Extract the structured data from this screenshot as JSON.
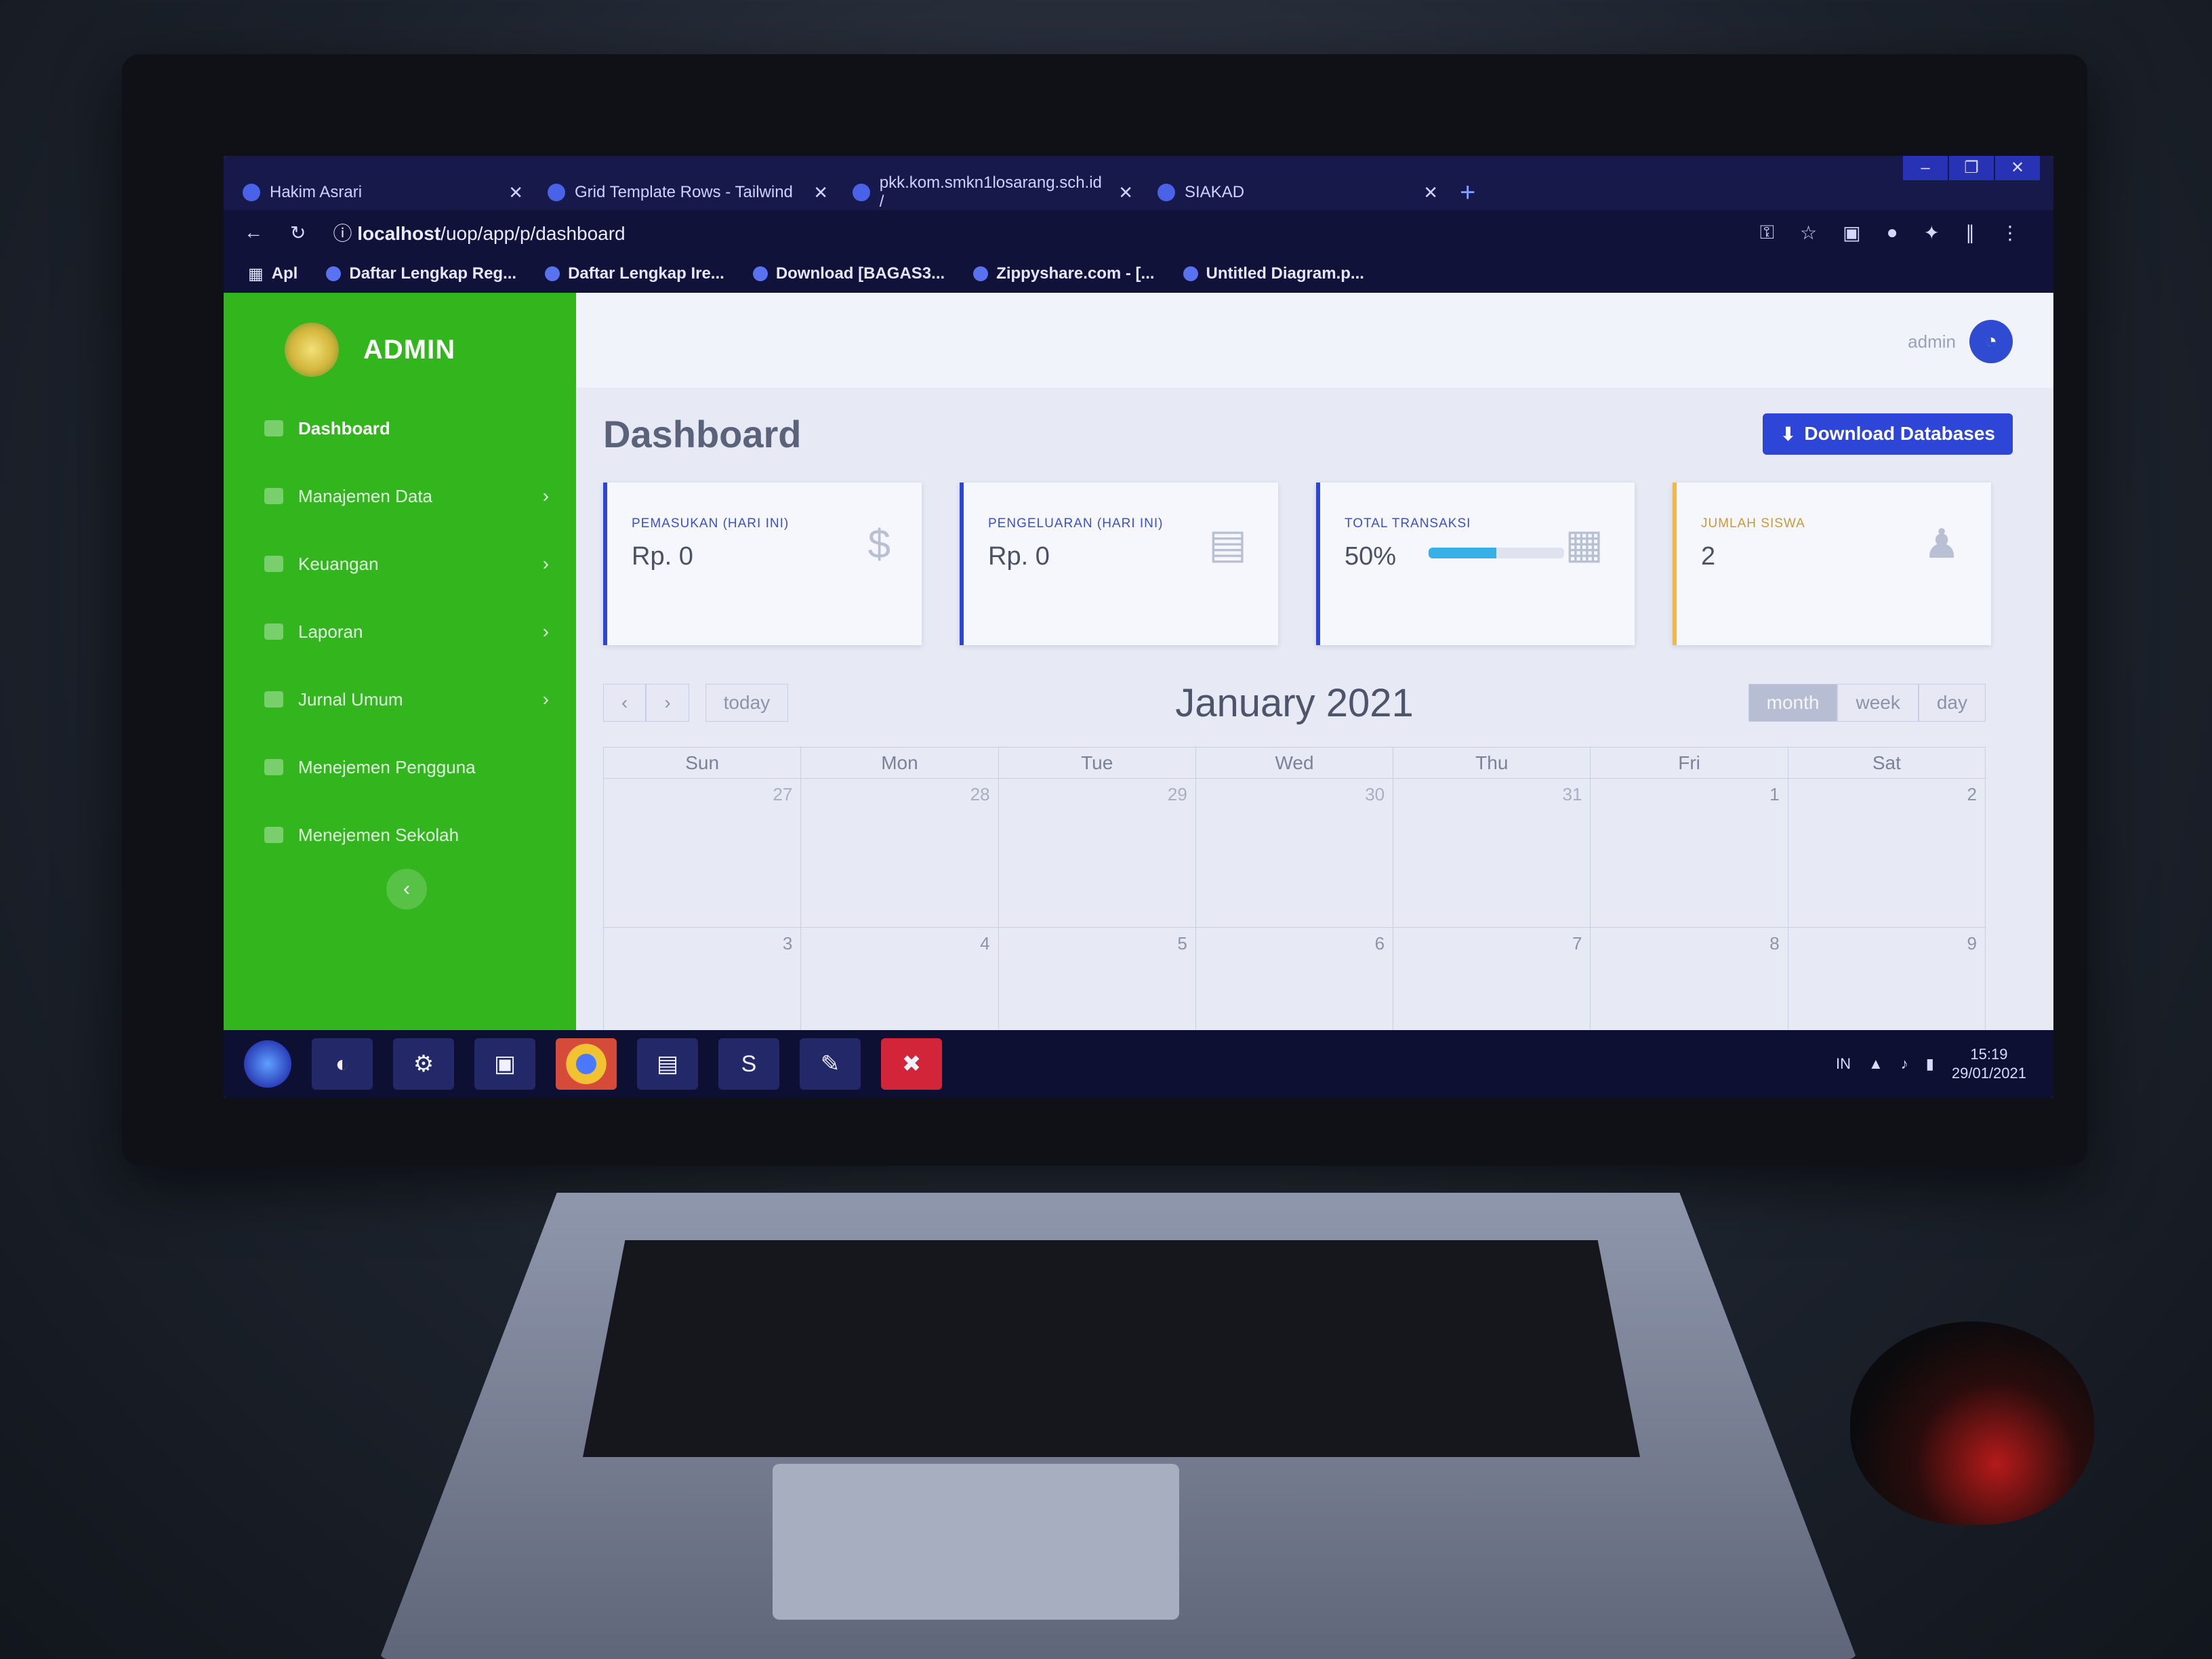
{
  "window_controls": [
    "–",
    "❐",
    "✕"
  ],
  "tabs": [
    {
      "label": "Hakim Asrari"
    },
    {
      "label": "Grid Template Rows - Tailwind"
    },
    {
      "label": "pkk.kom.smkn1losarang.sch.id /"
    },
    {
      "label": "SIAKAD"
    }
  ],
  "address": {
    "host": "localhost",
    "path": "/uop/app/p/dashboard"
  },
  "bookmarks": [
    {
      "label": "Apl"
    },
    {
      "label": "Daftar Lengkap Reg..."
    },
    {
      "label": "Daftar Lengkap Ire..."
    },
    {
      "label": "Download [BAGAS3..."
    },
    {
      "label": "Zippyshare.com - [..."
    },
    {
      "label": "Untitled Diagram.p..."
    }
  ],
  "sidebar": {
    "brand": "ADMIN",
    "items": [
      {
        "label": "Dashboard",
        "active": true,
        "chevron": ""
      },
      {
        "label": "Manajemen Data",
        "chevron": "›"
      },
      {
        "label": "Keuangan",
        "chevron": "›"
      },
      {
        "label": "Laporan",
        "chevron": "›"
      },
      {
        "label": "Jurnal Umum",
        "chevron": "›"
      },
      {
        "label": "Menejemen Pengguna",
        "chevron": ""
      },
      {
        "label": "Menejemen Sekolah",
        "chevron": ""
      }
    ],
    "collapse_icon": "‹"
  },
  "topbar": {
    "user_name": "admin"
  },
  "page": {
    "title": "Dashboard",
    "download_button": "Download Databases"
  },
  "cards": [
    {
      "label": "PEMASUKAN (HARI INI)",
      "value": "Rp. 0",
      "icon": "dollar-icon",
      "glyph": "$"
    },
    {
      "label": "PENGELUARAN (HARI INI)",
      "value": "Rp. 0",
      "icon": "invoice-icon",
      "glyph": "▤"
    },
    {
      "label": "TOTAL TRANSAKSI",
      "value": "50%",
      "icon": "clipboard-icon",
      "glyph": "▦",
      "progress": 0.5
    },
    {
      "label": "JUMLAH SISWA",
      "value": "2",
      "icon": "graduate-icon",
      "glyph": "♟"
    }
  ],
  "calendar": {
    "title": "January 2021",
    "prev": "‹",
    "next": "›",
    "today": "today",
    "views": [
      {
        "label": "month",
        "active": true
      },
      {
        "label": "week"
      },
      {
        "label": "day"
      }
    ],
    "weekdays": [
      "Sun",
      "Mon",
      "Tue",
      "Wed",
      "Thu",
      "Fri",
      "Sat"
    ],
    "weeks": [
      [
        {
          "d": "27",
          "other": true
        },
        {
          "d": "28",
          "other": true
        },
        {
          "d": "29",
          "other": true
        },
        {
          "d": "30",
          "other": true
        },
        {
          "d": "31",
          "other": true
        },
        {
          "d": "1"
        },
        {
          "d": "2"
        }
      ],
      [
        {
          "d": "3"
        },
        {
          "d": "4"
        },
        {
          "d": "5"
        },
        {
          "d": "6"
        },
        {
          "d": "7"
        },
        {
          "d": "8"
        },
        {
          "d": "9"
        }
      ]
    ]
  },
  "taskbar": {
    "lang": "IN",
    "time": "15:19",
    "date": "29/01/2021"
  },
  "colors": {
    "sidebar": "#32b51d",
    "accent": "#2d46d8",
    "card_border": "#2b45d4"
  }
}
